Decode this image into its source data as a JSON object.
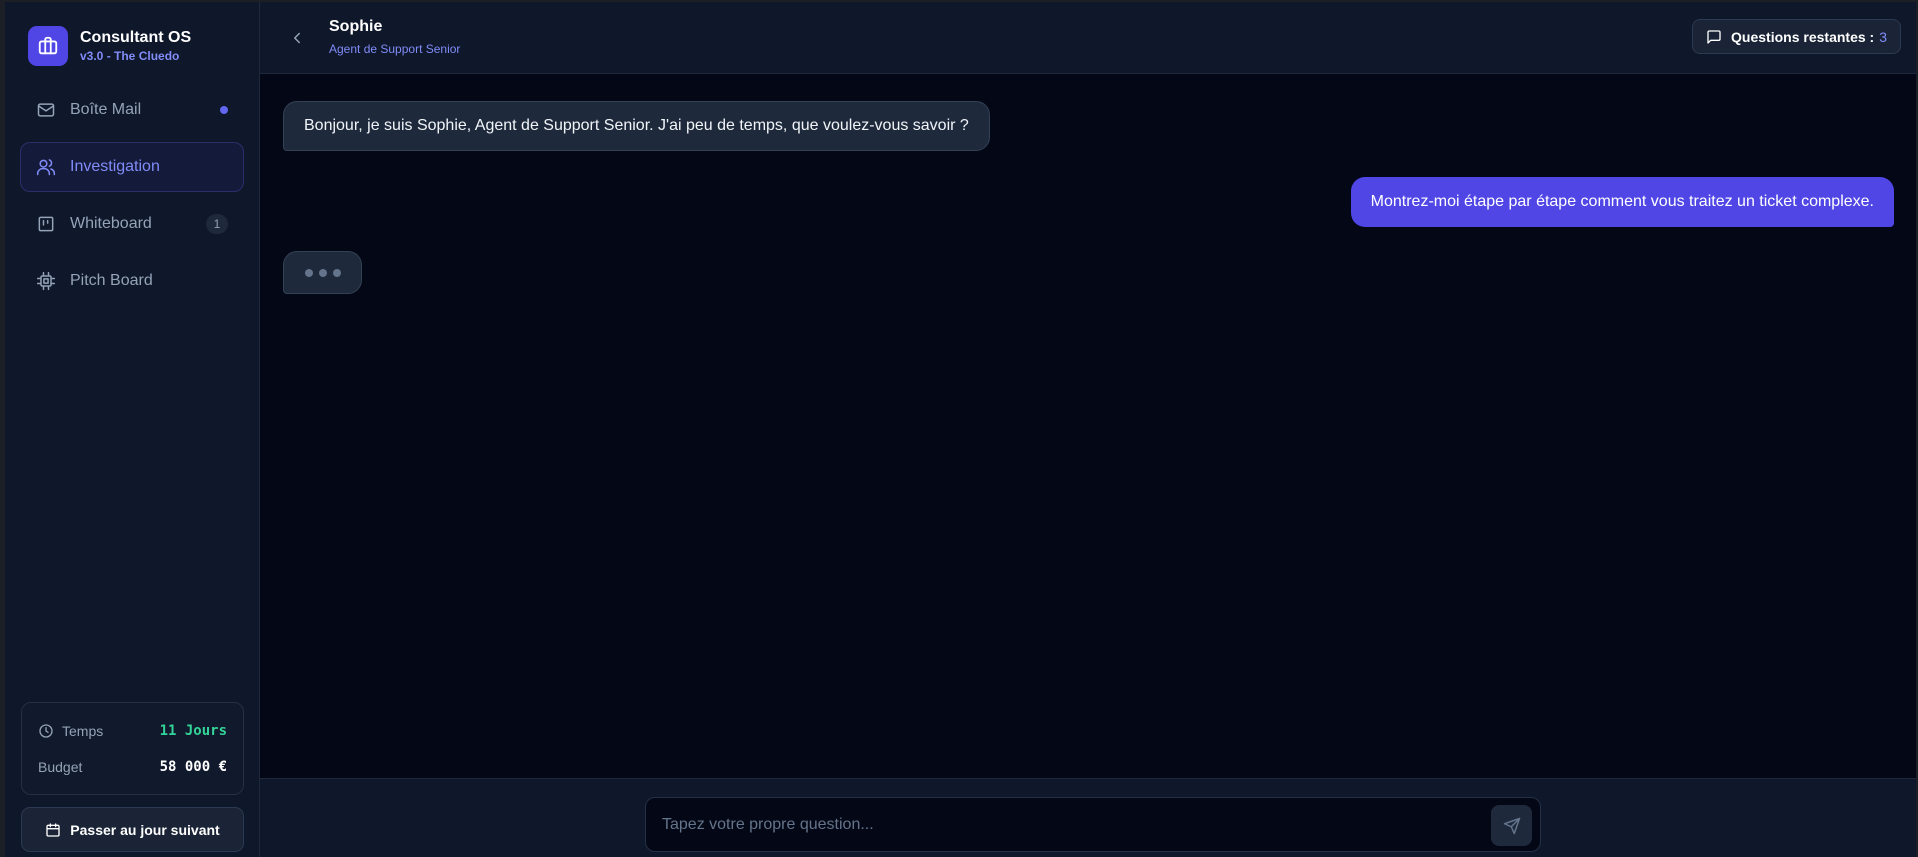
{
  "brand": {
    "title": "Consultant OS",
    "subtitle": "v3.0 - The Cluedo"
  },
  "nav": {
    "items": [
      {
        "label": "Boîte Mail",
        "icon": "mail-icon",
        "indicator": "dot"
      },
      {
        "label": "Investigation",
        "icon": "users-icon",
        "active": true
      },
      {
        "label": "Whiteboard",
        "icon": "board-icon",
        "badge": "1"
      },
      {
        "label": "Pitch Board",
        "icon": "chip-icon"
      }
    ]
  },
  "status": {
    "time_label": "Temps",
    "time_value": "11 Jours",
    "budget_label": "Budget",
    "budget_value": "58 000 €",
    "time_color": "#34d399"
  },
  "next_day_label": "Passer au jour suivant",
  "header": {
    "agent_name": "Sophie",
    "agent_role": "Agent de Support Senior",
    "questions_label": "Questions restantes :",
    "questions_count": "3"
  },
  "messages": [
    {
      "from": "agent",
      "text": "Bonjour, je suis Sophie, Agent de Support Senior. J'ai peu de temps, que voulez-vous savoir ?"
    },
    {
      "from": "user",
      "text": "Montrez-moi étape par étape comment vous traitez un ticket complexe."
    }
  ],
  "composer": {
    "placeholder": "Tapez votre propre question..."
  },
  "colors": {
    "accent": "#4f46e5",
    "accent_light": "#818cf8",
    "background": "#040816",
    "panel": "#0f172a"
  }
}
